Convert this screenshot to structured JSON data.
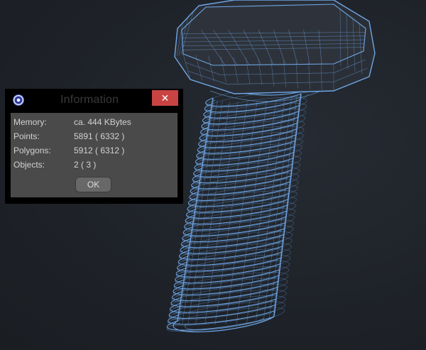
{
  "dialog": {
    "title": "Information",
    "close_glyph": "✕",
    "rows": [
      {
        "label": "Memory:",
        "value": "ca. 444 KBytes"
      },
      {
        "label": "Points:",
        "value": "5891 ( 6332 )"
      },
      {
        "label": "Polygons:",
        "value": "5912 ( 6312 )"
      },
      {
        "label": "Objects:",
        "value": "2 ( 3 )"
      }
    ],
    "ok_label": "OK"
  },
  "viewport": {
    "model": "hex-bolt-wireframe",
    "wire_color": "#6fa6e6",
    "background_color": "#20242b"
  },
  "icons": {
    "app": "cinema4d-logo-icon",
    "close": "close-icon"
  }
}
